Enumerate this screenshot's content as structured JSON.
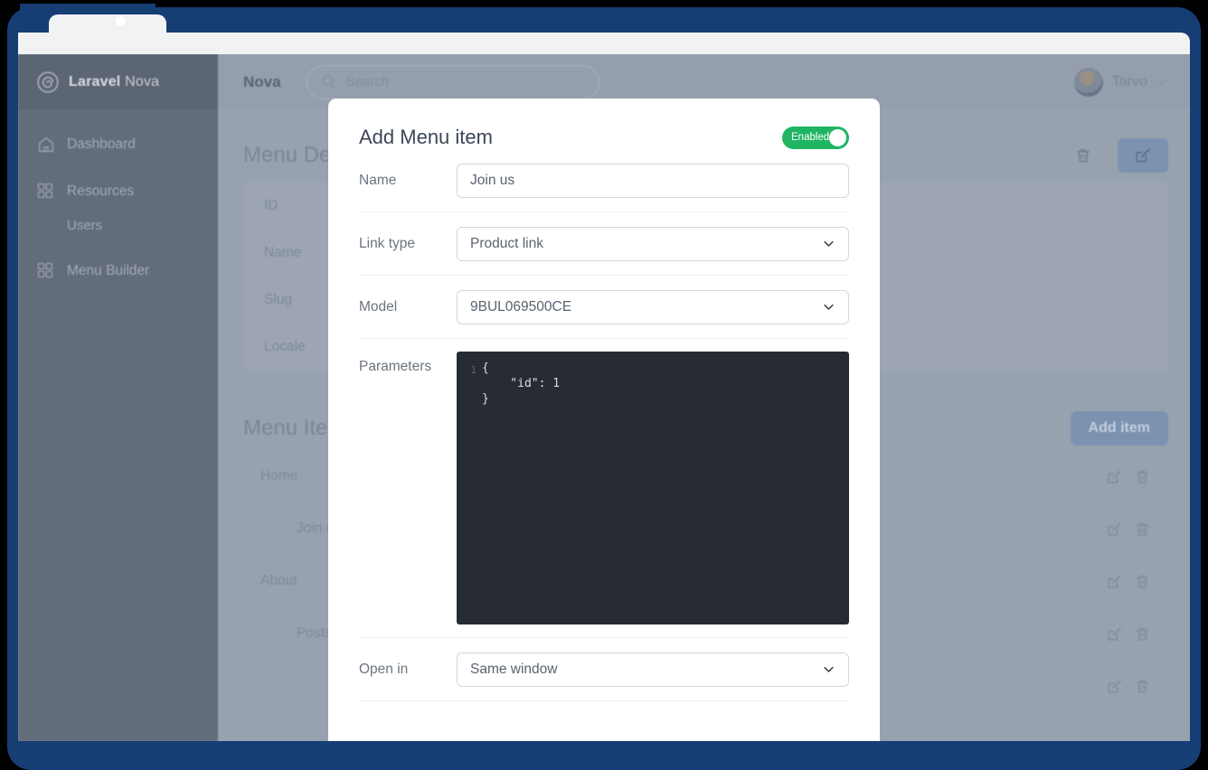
{
  "browser": {
    "tab_favicon_icon": "favicon-dot"
  },
  "sidebar": {
    "brand_bold": "Laravel",
    "brand_light": " Nova",
    "brand_logo_icon": "laravel-nova-spiral-logo",
    "items": [
      {
        "label": "Dashboard",
        "icon": "home-icon",
        "sub": false
      },
      {
        "label": "Resources",
        "icon": "grid-icon",
        "sub": false
      },
      {
        "label": "Users",
        "icon": "",
        "sub": true
      },
      {
        "label": "Menu Builder",
        "icon": "grid-icon",
        "sub": false
      }
    ]
  },
  "topbar": {
    "brand": "Nova",
    "search_placeholder": "Search",
    "search_value": "",
    "search_icon": "search-icon",
    "user_name": "Tarvo",
    "user_chevron_icon": "chevron-down-icon",
    "avatar_icon": "user-avatar"
  },
  "page": {
    "detail_title": "Menu Detail",
    "detail_rows": [
      {
        "label": "ID"
      },
      {
        "label": "Name"
      },
      {
        "label": "Slug"
      },
      {
        "label": "Locale"
      }
    ],
    "detail_actions": {
      "delete_icon": "trash-icon",
      "edit_icon": "pencil-square-icon"
    },
    "items_title": "Menu Items",
    "add_item_label": "Add item",
    "menu_items": [
      {
        "label": "Home",
        "indent": false
      },
      {
        "label": "Join us",
        "indent": true
      },
      {
        "label": "About",
        "indent": false
      },
      {
        "label": "Posts",
        "indent": true
      },
      {
        "label": "",
        "indent": false
      }
    ],
    "row_actions": {
      "edit_icon": "pencil-square-icon",
      "delete_icon": "trash-icon"
    }
  },
  "modal": {
    "title": "Add Menu item",
    "enabled_toggle": {
      "label": "Enabled",
      "state": "on",
      "color": "#1fb563"
    },
    "fields": {
      "name": {
        "label": "Name",
        "value": "Join us",
        "placeholder": ""
      },
      "link_type": {
        "label": "Link type",
        "value": "Product link",
        "chevron_icon": "chevron-down-icon"
      },
      "model": {
        "label": "Model",
        "value": "9BUL069500CE",
        "chevron_icon": "chevron-down-icon"
      },
      "parameters": {
        "label": "Parameters",
        "line_numbers": "1",
        "code": "{\n    \"id\": 1\n}",
        "background": "#272b33"
      },
      "open_in": {
        "label": "Open in",
        "value": "Same window",
        "chevron_icon": "chevron-down-icon"
      }
    }
  },
  "colors": {
    "device_frame": "#173D75",
    "sidebar": "#636c7a",
    "page_bg": "#98a2ae",
    "accent_green": "#1fb563",
    "primary_button": "#7b93b1"
  }
}
